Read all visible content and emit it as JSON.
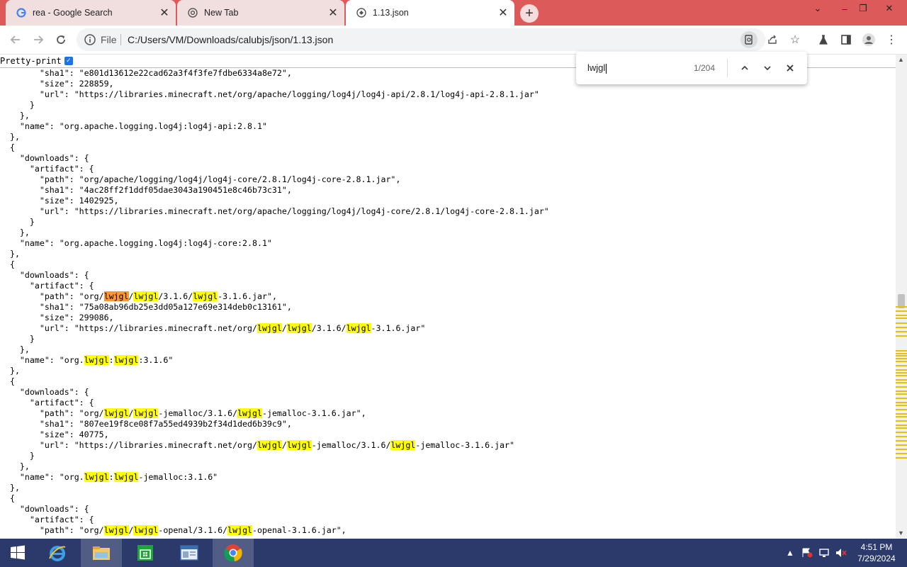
{
  "tabs": [
    {
      "title": "rea - Google Search",
      "favicon": "google-g-icon",
      "active": false
    },
    {
      "title": "New Tab",
      "favicon": "chrome-icon",
      "active": false
    },
    {
      "title": "1.13.json",
      "favicon": "globe-icon",
      "active": true
    }
  ],
  "toolbar": {
    "file_label": "File",
    "url": "C:/Users/VM/Downloads/calubjs/json/1.13.json"
  },
  "viewer": {
    "pretty_print_label": "Pretty-print",
    "pretty_print_checked": true
  },
  "find": {
    "query": "lwjgl",
    "count": "1/204"
  },
  "json_lines": [
    "        \"sha1\": \"e801d13612e22cad62a3f4f3fe7fdbe6334a8e72\",",
    "        \"size\": 228859,",
    "        \"url\": \"https://libraries.minecraft.net/org/apache/logging/log4j/log4j-api/2.8.1/log4j-api-2.8.1.jar\"",
    "      }",
    "    },",
    "    \"name\": \"org.apache.logging.log4j:log4j-api:2.8.1\"",
    "  },",
    "  {",
    "    \"downloads\": {",
    "      \"artifact\": {",
    "        \"path\": \"org/apache/logging/log4j/log4j-core/2.8.1/log4j-core-2.8.1.jar\",",
    "        \"sha1\": \"4ac28ff2f1ddf05dae3043a190451e8c46b73c31\",",
    "        \"size\": 1402925,",
    "        \"url\": \"https://libraries.minecraft.net/org/apache/logging/log4j/log4j-core/2.8.1/log4j-core-2.8.1.jar\"",
    "      }",
    "    },",
    "    \"name\": \"org.apache.logging.log4j:log4j-core:2.8.1\"",
    "  },",
    "  {",
    "    \"downloads\": {",
    "      \"artifact\": {",
    "        \"path\": \"org/lwjgl/lwjgl/3.1.6/lwjgl-3.1.6.jar\",",
    "        \"sha1\": \"75a08ab96db25e3dd05a127e69e314deb0c13161\",",
    "        \"size\": 299086,",
    "        \"url\": \"https://libraries.minecraft.net/org/lwjgl/lwjgl/3.1.6/lwjgl-3.1.6.jar\"",
    "      }",
    "    },",
    "    \"name\": \"org.lwjgl:lwjgl:3.1.6\"",
    "  },",
    "  {",
    "    \"downloads\": {",
    "      \"artifact\": {",
    "        \"path\": \"org/lwjgl/lwjgl-jemalloc/3.1.6/lwjgl-jemalloc-3.1.6.jar\",",
    "        \"sha1\": \"807ee19f8ce08f7a55ed4939b2f34d1ded6b39c9\",",
    "        \"size\": 40775,",
    "        \"url\": \"https://libraries.minecraft.net/org/lwjgl/lwjgl-jemalloc/3.1.6/lwjgl-jemalloc-3.1.6.jar\"",
    "      }",
    "    },",
    "    \"name\": \"org.lwjgl:lwjgl-jemalloc:3.1.6\"",
    "  },",
    "  {",
    "    \"downloads\": {",
    "      \"artifact\": {",
    "        \"path\": \"org/lwjgl/lwjgl-openal/3.1.6/lwjgl-openal-3.1.6.jar\","
  ],
  "taskbar": {
    "apps": [
      "start-icon",
      "internet-explorer-icon",
      "file-explorer-icon",
      "store-icon",
      "document-viewer-icon",
      "chrome-icon"
    ],
    "time": "4:51 PM",
    "date": "7/29/2024"
  },
  "colors": {
    "tabbar": "#dd5a5a",
    "match_highlight": "#ffff00",
    "current_match_highlight": "#ff9632",
    "taskbar": "#2b3a6b"
  }
}
